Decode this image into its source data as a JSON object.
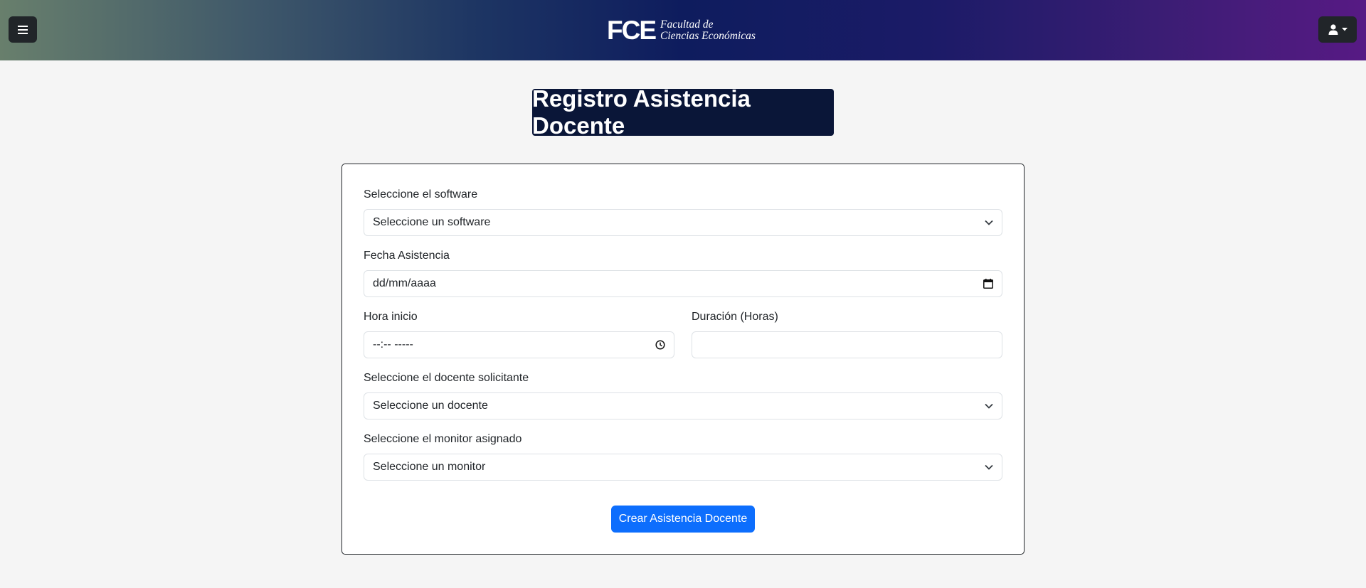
{
  "header": {
    "logo_mark": "FCE",
    "logo_line1": "Facultad de",
    "logo_line2": "Ciencias Económicas"
  },
  "page_title": "Registro Asistencia Docente",
  "form": {
    "software": {
      "label": "Seleccione el software",
      "value": "Seleccione un software"
    },
    "fecha": {
      "label": "Fecha Asistencia",
      "value": "dd/mm/aaaa"
    },
    "hora": {
      "label": "Hora inicio",
      "value": "--:-- -----"
    },
    "duracion": {
      "label": "Duración (Horas)",
      "value": ""
    },
    "docente": {
      "label": "Seleccione el docente solicitante",
      "value": "Seleccione un docente"
    },
    "monitor": {
      "label": "Seleccione el monitor asignado",
      "value": "Seleccione un monitor"
    },
    "submit_label": "Crear Asistencia Docente"
  },
  "colors": {
    "primary": "#0d6efd",
    "title_bg": "#0a1638",
    "dark": "#212529"
  },
  "icons": [
    "hamburger-menu-icon",
    "user-icon",
    "caret-down-icon",
    "chevron-down-icon",
    "calendar-icon",
    "clock-icon"
  ]
}
